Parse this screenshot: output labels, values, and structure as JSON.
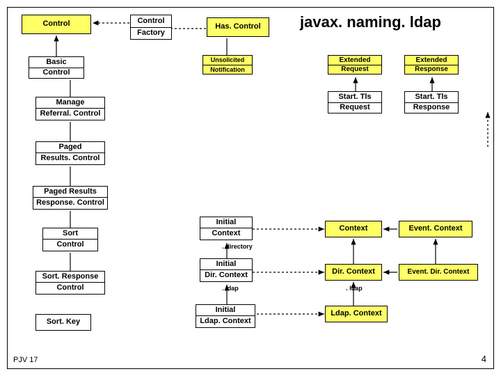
{
  "title": "javax. naming. ldap",
  "boxes": {
    "control1": "Control",
    "control2": "Control",
    "factory": "Factory",
    "hascontrol": "Has. Control",
    "basic": "Basic",
    "control3": "Control",
    "unsolicited": "Unsolicited",
    "notification": "Notification",
    "extended1": "Extended",
    "request1": "Request",
    "extended2": "Extended",
    "response1": "Response",
    "manage": "Manage",
    "referral": "Referral. Control",
    "starttls1": "Start. Tls",
    "request2": "Request",
    "starttls2": "Start. Tls",
    "response2": "Response",
    "paged": "Paged",
    "results": "Results. Control",
    "pagedresults": "Paged Results",
    "responsecontrol": "Response. Control",
    "sort": "Sort",
    "control4": "Control",
    "sortresponse": "Sort. Response",
    "control5": "Control",
    "sortkey": "Sort. Key",
    "initial1": "Initial",
    "context1": "Context",
    "initial2": "Initial",
    "dircontext1": "Dir. Context",
    "initial3": "Initial",
    "ldapcontext1": "Ldap. Context",
    "context2": "Context",
    "dircontext2": "Dir. Context",
    "ldapcontext2": "Ldap. Context",
    "eventcontext": "Event. Context",
    "eventdircontext": "Event. Dir. Context"
  },
  "labels": {
    "directory": ". directory",
    "ldap1": ". ldap",
    "ldap2": ". ldap"
  },
  "footer": {
    "left": "PJV 17",
    "right": "4"
  }
}
